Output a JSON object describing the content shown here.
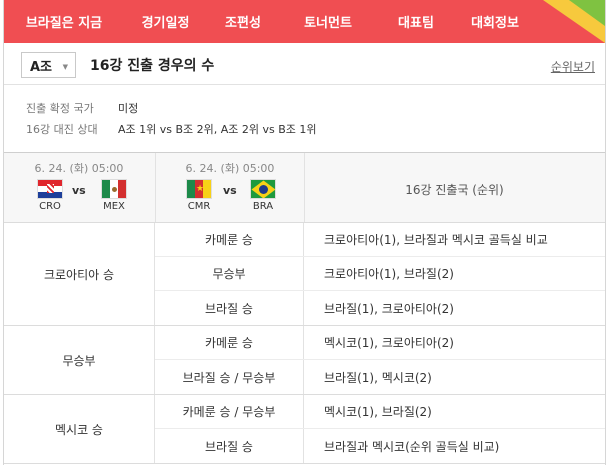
{
  "nav": {
    "items": [
      "브라질은 지금",
      "경기일정",
      "조편성",
      "토너먼트",
      "대표팀",
      "대회정보"
    ]
  },
  "header": {
    "group_value": "A조",
    "caret": "▼",
    "title": "16강 진출 경우의 수",
    "rank_link": "순위보기"
  },
  "info": {
    "confirmed_label": "진출 확정 국가",
    "confirmed_value": "미정",
    "matchup_label": "16강 대진 상대",
    "matchup_value": "A조 1위 vs B조 2위, A조 2위 vs B조 1위"
  },
  "matches": [
    {
      "date": "6. 24. (화) 05:00",
      "home": "CRO",
      "away": "MEX",
      "vs": "vs"
    },
    {
      "date": "6. 24. (화) 05:00",
      "home": "CMR",
      "away": "BRA",
      "vs": "vs"
    }
  ],
  "table_header": "16강 진출국 (순위)",
  "groups": [
    {
      "label": "크로아티아 승",
      "rows": [
        {
          "result": "카메룬 승",
          "outcome": "크로아티아(1), 브라질과 멕시코 골득실 비교"
        },
        {
          "result": "무승부",
          "outcome": "크로아티아(1), 브라질(2)"
        },
        {
          "result": "브라질 승",
          "outcome": "브라질(1), 크로아티아(2)"
        }
      ]
    },
    {
      "label": "무승부",
      "rows": [
        {
          "result": "카메룬 승",
          "outcome": "멕시코(1), 크로아티아(2)"
        },
        {
          "result": "브라질 승 / 무승부",
          "outcome": "브라질(1), 멕시코(2)"
        }
      ]
    },
    {
      "label": "멕시코 승",
      "rows": [
        {
          "result": "카메룬 승 / 무승부",
          "outcome": "멕시코(1), 브라질(2)"
        },
        {
          "result": "브라질 승",
          "outcome": "브라질과 멕시코(순위 골득실 비교)"
        }
      ]
    }
  ],
  "colors": {
    "nav_bg": "#f04e52",
    "corner_yellow": "#f7c93d",
    "corner_green": "#7fc241"
  }
}
